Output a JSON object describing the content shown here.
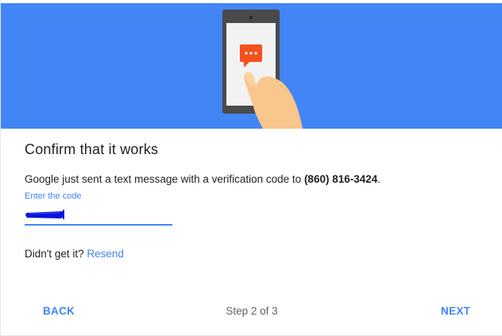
{
  "header": {
    "illustration": "phone-with-message-icon",
    "background_color": "#4285f4"
  },
  "content": {
    "title": "Confirm that it works",
    "description_prefix": "Google just sent a text message with a verification code to ",
    "phone_number": "(860) 816-3424",
    "description_suffix": ".",
    "code_label": "Enter the code",
    "code_value": "",
    "resend_prefix": "Didn't get it? ",
    "resend_link": "Resend"
  },
  "footer": {
    "back_label": "BACK",
    "step_text": "Step 2 of 3",
    "next_label": "NEXT"
  },
  "colors": {
    "accent": "#4285f4",
    "text": "#212121",
    "secondary_text": "#5f6368"
  }
}
